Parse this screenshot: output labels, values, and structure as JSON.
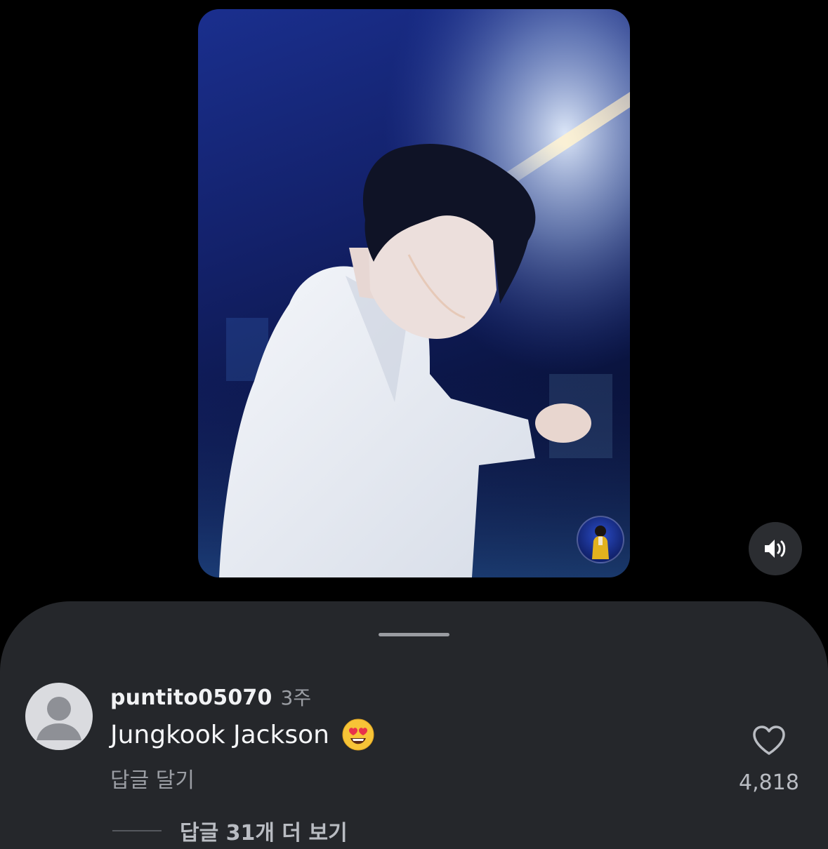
{
  "video": {
    "creator_avatar_label": "creator-avatar"
  },
  "controls": {
    "mute_icon": "speaker-volume-icon"
  },
  "comment": {
    "username": "puntito05070",
    "timestamp": "3주",
    "text": "Jungkook Jackson",
    "emoji": "heart-eyes-emoji",
    "reply_label": "답글 달기",
    "like_count": "4,818",
    "view_replies_label": "답글 31개 더 보기"
  },
  "colors": {
    "background": "#000000",
    "sheet": "#25272b",
    "secondary_text": "#9b9ea4"
  }
}
